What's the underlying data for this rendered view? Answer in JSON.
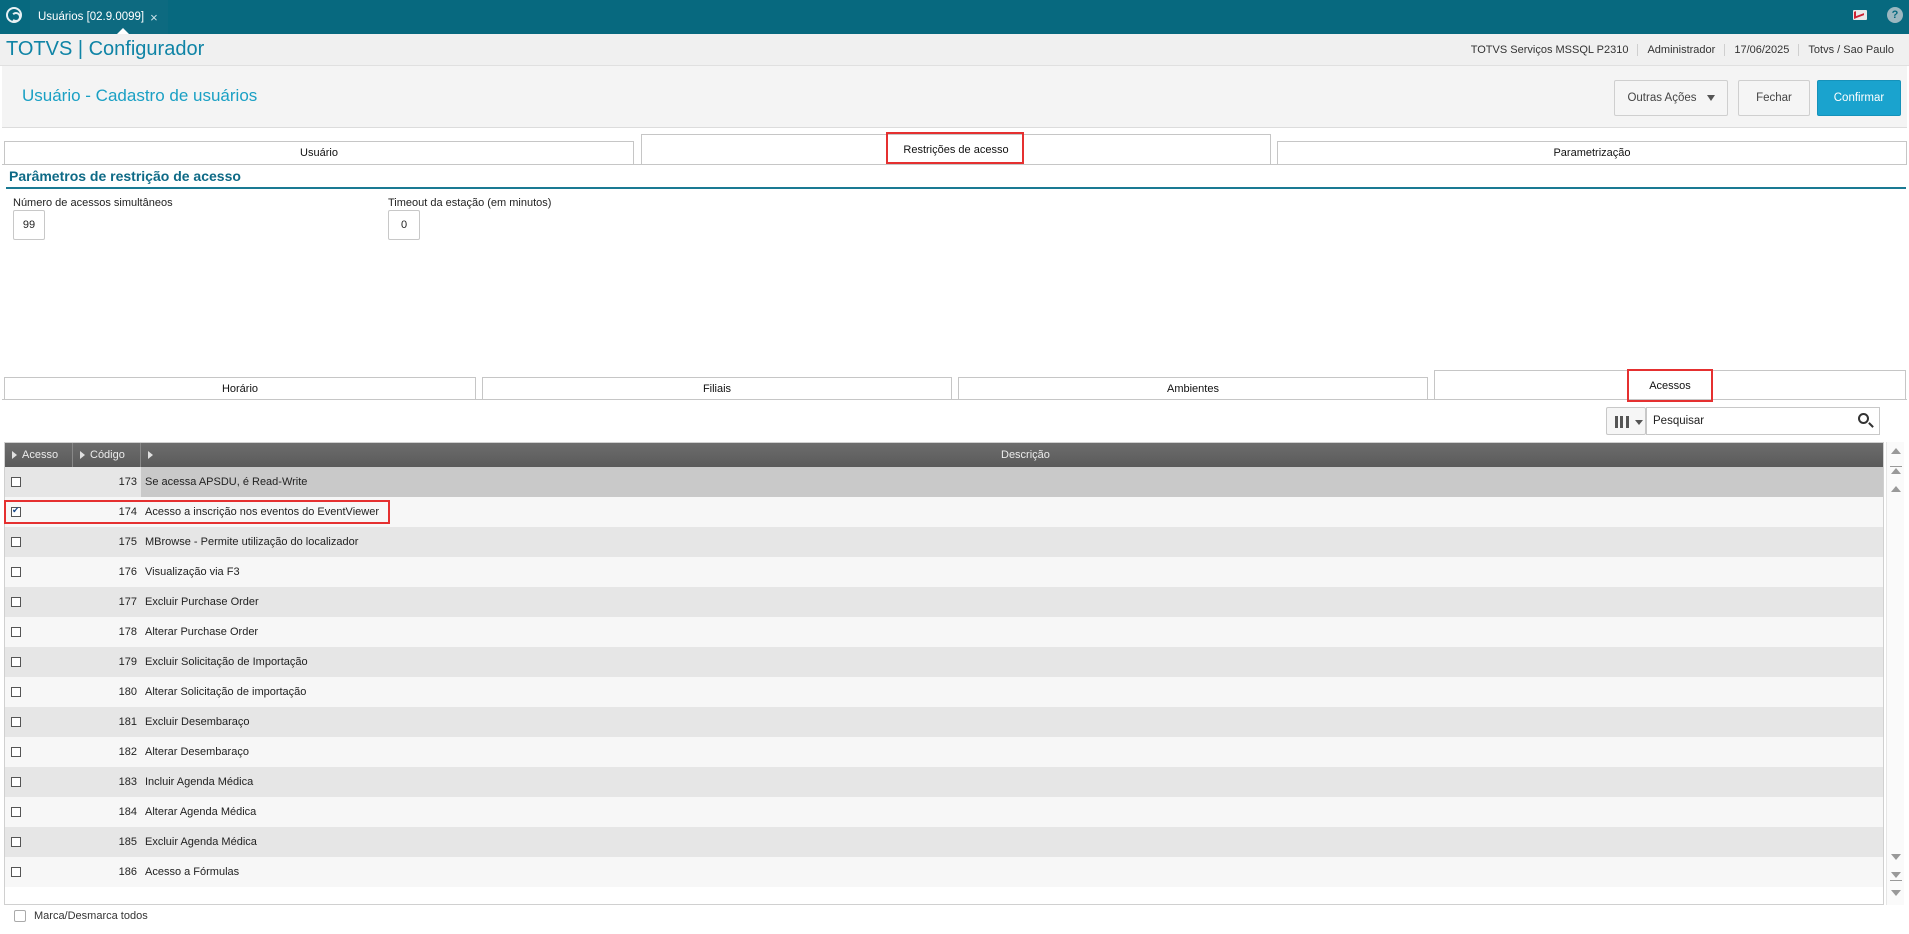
{
  "window": {
    "tab_label": "Usuários [02.9.0099]",
    "close_glyph": "×"
  },
  "app": {
    "brand": "TOTVS | Configurador",
    "server": "TOTVS Serviços MSSQL P2310",
    "user": "Administrador",
    "date": "17/06/2025",
    "location": "Totvs / Sao Paulo"
  },
  "page": {
    "title": "Usuário - Cadastro de usuários",
    "actions": {
      "outras": "Outras Ações",
      "fechar": "Fechar",
      "confirmar": "Confirmar"
    }
  },
  "tabs": [
    "Usuário",
    "Restrições de acesso",
    "Parametrização"
  ],
  "section": {
    "title": "Parâmetros de restrição de acesso",
    "fields": [
      {
        "label": "Número de acessos simultâneos",
        "value": "99"
      },
      {
        "label": "Timeout da estação (em minutos)",
        "value": "0"
      }
    ]
  },
  "subtabs": [
    "Horário",
    "Filiais",
    "Ambientes",
    "Acessos"
  ],
  "search": {
    "placeholder": "Pesquisar"
  },
  "grid": {
    "headers": {
      "acesso": "Acesso",
      "codigo": "Código",
      "descricao": "Descrição"
    },
    "rows": [
      {
        "checked": false,
        "code": "173",
        "desc": "Se acessa APSDU, é Read-Write"
      },
      {
        "checked": true,
        "code": "174",
        "desc": "Acesso a inscrição nos eventos do EventViewer"
      },
      {
        "checked": false,
        "code": "175",
        "desc": "MBrowse - Permite utilização do localizador"
      },
      {
        "checked": false,
        "code": "176",
        "desc": "Visualização via F3"
      },
      {
        "checked": false,
        "code": "177",
        "desc": "Excluir Purchase Order"
      },
      {
        "checked": false,
        "code": "178",
        "desc": "Alterar Purchase Order"
      },
      {
        "checked": false,
        "code": "179",
        "desc": "Excluir Solicitação de Importação"
      },
      {
        "checked": false,
        "code": "180",
        "desc": "Alterar Solicitação de importação"
      },
      {
        "checked": false,
        "code": "181",
        "desc": "Excluir Desembaraço"
      },
      {
        "checked": false,
        "code": "182",
        "desc": "Alterar Desembaraço"
      },
      {
        "checked": false,
        "code": "183",
        "desc": "Incluir Agenda Médica"
      },
      {
        "checked": false,
        "code": "184",
        "desc": "Alterar Agenda Médica"
      },
      {
        "checked": false,
        "code": "185",
        "desc": "Excluir Agenda Médica"
      },
      {
        "checked": false,
        "code": "186",
        "desc": "Acesso a Fórmulas"
      }
    ]
  },
  "footer": {
    "mark_all": "Marca/Desmarca todos"
  },
  "colors": {
    "topbar": "#07697f",
    "brand": "#0f84a6",
    "accent": "#1aa3ce",
    "highlight": "#e53030"
  },
  "icons": [
    "totvs-logo-icon",
    "close-icon",
    "mail-icon",
    "help-icon",
    "columns-icon",
    "search-icon",
    "scroll-up-icon",
    "scroll-down-icon"
  ]
}
